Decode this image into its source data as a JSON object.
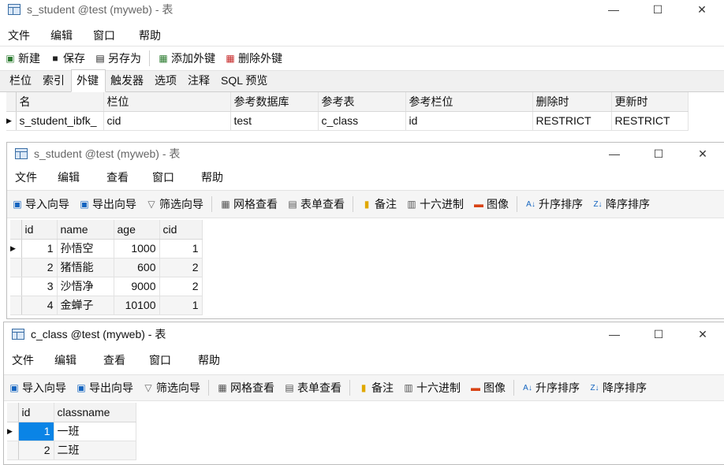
{
  "w1": {
    "title": "s_student @test (myweb) - 表",
    "win_btns": [
      "—",
      "☐",
      "✕"
    ],
    "menu": [
      "文件",
      "编辑",
      "窗口",
      "帮助"
    ],
    "toolbar": {
      "new": "新建",
      "save": "保存",
      "save_as": "另存为",
      "add_fk": "添加外键",
      "del_fk": "删除外键"
    },
    "tabs": [
      "栏位",
      "索引",
      "外键",
      "触发器",
      "选项",
      "注释",
      "SQL 预览"
    ],
    "fk_headers": [
      "名",
      "栏位",
      "参考数据库",
      "参考表",
      "参考栏位",
      "删除时",
      "更新时"
    ],
    "fk_rows": [
      [
        "s_student_ibfk_",
        "cid",
        "test",
        "c_class",
        "id",
        "RESTRICT",
        "RESTRICT"
      ]
    ]
  },
  "w2": {
    "title": "s_student @test (myweb) - 表",
    "win_btns": [
      "—",
      "☐",
      "✕"
    ],
    "menu": [
      "文件",
      "编辑",
      "查看",
      "窗口",
      "帮助"
    ],
    "toolbar": {
      "import": "导入向导",
      "export": "导出向导",
      "filter": "筛选向导",
      "grid_view": "网格查看",
      "form_view": "表单查看",
      "memo": "备注",
      "hex": "十六进制",
      "image": "图像",
      "sort_asc": "升序排序",
      "sort_desc": "降序排序"
    },
    "headers": [
      "id",
      "name",
      "age",
      "cid"
    ],
    "rows": [
      [
        "1",
        "孙悟空",
        "1000",
        "1"
      ],
      [
        "2",
        "猪悟能",
        "600",
        "2"
      ],
      [
        "3",
        "沙悟净",
        "9000",
        "2"
      ],
      [
        "4",
        "金蝉子",
        "10100",
        "1"
      ]
    ]
  },
  "w3": {
    "title": "c_class @test (myweb) - 表",
    "win_btns": [
      "—",
      "☐",
      "✕"
    ],
    "menu": [
      "文件",
      "编辑",
      "查看",
      "窗口",
      "帮助"
    ],
    "toolbar": {
      "import": "导入向导",
      "export": "导出向导",
      "filter": "筛选向导",
      "grid_view": "网格查看",
      "form_view": "表单查看",
      "memo": "备注",
      "hex": "十六进制",
      "image": "图像",
      "sort_asc": "升序排序",
      "sort_desc": "降序排序"
    },
    "headers": [
      "id",
      "classname"
    ],
    "rows": [
      [
        "1",
        "一班"
      ],
      [
        "2",
        "二班"
      ]
    ]
  }
}
